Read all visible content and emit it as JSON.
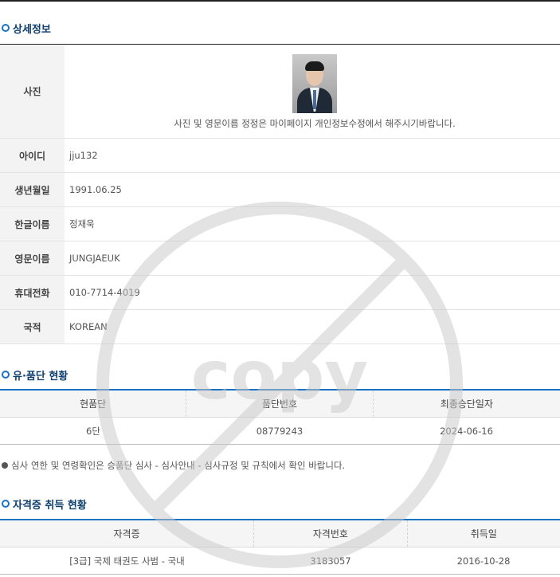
{
  "sections": {
    "detail_title": "상세정보",
    "dan_title": "유·품단 현황",
    "cert_title": "자격증 취득 현황"
  },
  "profile": {
    "photo_label": "사진",
    "photo_note": "사진 및 영문이름 정정은 마이페이지 개인정보수정에서 해주시기바랍니다.",
    "rows": [
      {
        "label": "아이디",
        "value": "jju132"
      },
      {
        "label": "생년월일",
        "value": "1991.06.25"
      },
      {
        "label": "한글이름",
        "value": "정재욱"
      },
      {
        "label": "영문이름",
        "value": "JUNGJAEUK"
      },
      {
        "label": "휴대전화",
        "value": "010-7714-4019"
      },
      {
        "label": "국적",
        "value": "KOREAN"
      }
    ]
  },
  "dan_table": {
    "headers": [
      "현품단",
      "품단번호",
      "최종승단일자"
    ],
    "rows": [
      [
        "6단",
        "08779243",
        "2024-06-16"
      ]
    ]
  },
  "notice": "심사 연한 및 연령확인은 승품단 심사 - 심사안내 - 심사규정 및 규칙에서 확인 바랍니다.",
  "cert_table": {
    "headers": [
      "자격증",
      "자격번호",
      "취득일"
    ],
    "rows": [
      [
        "[3급] 국제 태권도 사범 - 국내",
        "3183057",
        "2016-10-28"
      ]
    ]
  },
  "watermark": {
    "text": "copy",
    "icon": "no-copy-icon",
    "color": "#c8c8c8"
  },
  "colors": {
    "accent": "#1a72c2",
    "title": "#0e3f6e"
  }
}
